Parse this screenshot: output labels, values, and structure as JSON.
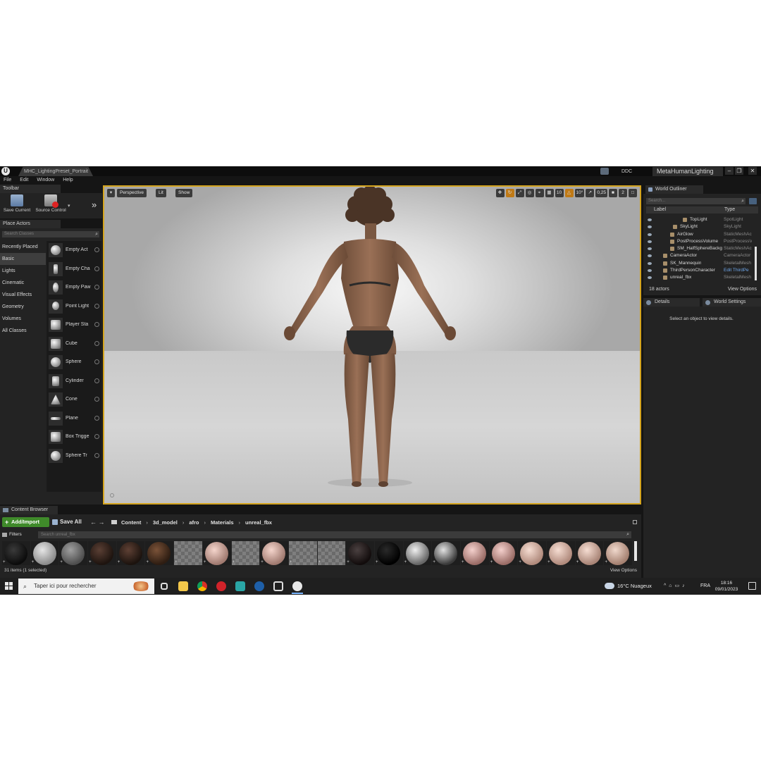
{
  "titlebar": {
    "level_tab": "MHC_LightingPreset_Portrait",
    "ddc_label": "DDC",
    "project_name": "MetaHumanLighting",
    "window_buttons": [
      "–",
      "❐",
      "✕"
    ]
  },
  "menu": [
    "File",
    "Edit",
    "Window",
    "Help"
  ],
  "toolbar": {
    "tab_label": "Toolbar",
    "save_current_label": "Save Current",
    "source_control_label": "Source Control"
  },
  "place_actors": {
    "tab_label": "Place Actors",
    "search_placeholder": "Search Classes",
    "categories": [
      "Recently Placed",
      "Basic",
      "Lights",
      "Cinematic",
      "Visual Effects",
      "Geometry",
      "Volumes",
      "All Classes"
    ],
    "active_category": "Basic",
    "actors": [
      {
        "label": "Empty Act",
        "icon": "sphere-icon"
      },
      {
        "label": "Empty Cha",
        "icon": "character-icon"
      },
      {
        "label": "Empty Paw",
        "icon": "pawn-icon"
      },
      {
        "label": "Point Light",
        "icon": "lightbulb-icon"
      },
      {
        "label": "Player Sta",
        "icon": "player-start-icon"
      },
      {
        "label": "Cube",
        "icon": "cube-icon"
      },
      {
        "label": "Sphere",
        "icon": "sphere-icon"
      },
      {
        "label": "Cylinder",
        "icon": "cylinder-icon"
      },
      {
        "label": "Cone",
        "icon": "cone-icon"
      },
      {
        "label": "Plane",
        "icon": "plane-icon"
      },
      {
        "label": "Box Trigge",
        "icon": "box-trigger-icon"
      },
      {
        "label": "Sphere Tr",
        "icon": "sphere-trigger-icon"
      }
    ]
  },
  "viewport": {
    "perspective_label": "Perspective",
    "lit_label": "Lit",
    "show_label": "Show",
    "grid_snap": "10",
    "rotation_snap": "10°",
    "scale_snap": "0,25",
    "camera_speed": "2"
  },
  "outliner": {
    "tab_label": "World Outliner",
    "search_placeholder": "Search...",
    "col_label": "Label",
    "col_type": "Type",
    "rows": [
      {
        "label": "TopLight",
        "type": "SpotLight",
        "indent": 3
      },
      {
        "label": "SkyLight",
        "type": "SkyLight",
        "indent": 2
      },
      {
        "label": "AirGlow",
        "type": "StaticMeshAc",
        "indent": 1
      },
      {
        "label": "PostProcessVolume",
        "type": "PostProcessV",
        "indent": 1
      },
      {
        "label": "SM_HalfSphereBackg",
        "type": "StaticMeshAc",
        "indent": 1
      },
      {
        "label": "CameraActor",
        "type": "CameraActor",
        "indent": 0
      },
      {
        "label": "SK_Mannequin",
        "type": "SkeletalMesh",
        "indent": 0
      },
      {
        "label": "ThirdPersonCharacter",
        "type": "Edit ThirdPe",
        "indent": 0,
        "link": true
      },
      {
        "label": "unreal_fbx",
        "type": "SkeletalMesh",
        "indent": 0
      }
    ],
    "actor_count": "18 actors",
    "view_options": "View Options"
  },
  "details": {
    "tab_details": "Details",
    "tab_world_settings": "World Settings",
    "empty_message": "Select an object to view details."
  },
  "content_browser": {
    "tab_label": "Content Browser",
    "add_import": "Add/Import",
    "save_all": "Save All",
    "path": [
      "Content",
      "3d_model",
      "afro",
      "Materials",
      "unreal_fbx"
    ],
    "filters_label": "Filters",
    "search_placeholder": "Search unreal_fbx",
    "item_count": "31 items (1 selected)",
    "view_options": "View Options"
  },
  "taskbar": {
    "search_placeholder": "Taper ici pour rechercher",
    "weather": "16°C  Nuageux",
    "language": "FRA",
    "time": "18:16",
    "date": "09/01/2023"
  }
}
